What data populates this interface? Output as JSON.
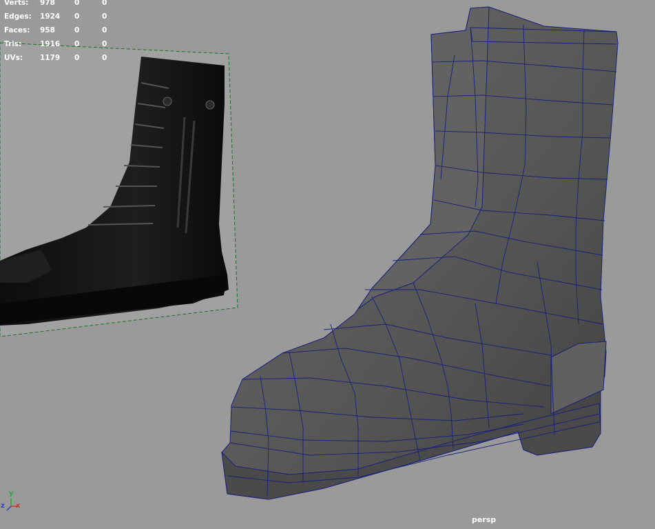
{
  "hud": {
    "rows": [
      {
        "label": "Verts:",
        "v1": "978",
        "v2": "0",
        "v3": "0"
      },
      {
        "label": "Edges:",
        "v1": "1924",
        "v2": "0",
        "v3": "0"
      },
      {
        "label": "Faces:",
        "v1": "958",
        "v2": "0",
        "v3": "0"
      },
      {
        "label": "Tris:",
        "v1": "1916",
        "v2": "0",
        "v3": "0"
      },
      {
        "label": "UVs:",
        "v1": "1179",
        "v2": "0",
        "v3": "0"
      }
    ]
  },
  "camera": {
    "name": "persp"
  },
  "axis": {
    "x": "x",
    "y": "y",
    "z": "z"
  },
  "colors": {
    "viewport_bg": "#9a9a9a",
    "wire": "#1a1f7a",
    "shade": "#545454",
    "plane_edge": "#1f6b2b"
  }
}
